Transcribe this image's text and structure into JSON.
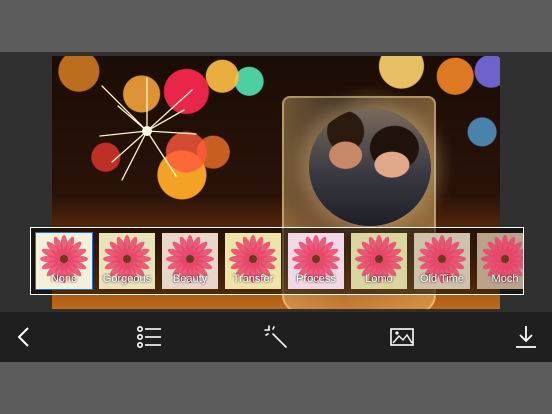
{
  "filters": [
    {
      "label": "None",
      "tint": "#f4f1d8",
      "selected": true
    },
    {
      "label": "Gorgeous",
      "tint": "#e8e3b8"
    },
    {
      "label": "Beauty",
      "tint": "#e7d6c9"
    },
    {
      "label": "Transfer",
      "tint": "#efe4a8"
    },
    {
      "label": "Process",
      "tint": "#f0d9e6"
    },
    {
      "label": "Lomo",
      "tint": "#d9d6a0"
    },
    {
      "label": "Old Time",
      "tint": "#cfc2ad"
    },
    {
      "label": "Moch",
      "tint": "#b9a38d"
    }
  ],
  "toolbar": {
    "icons": [
      "back-icon",
      "list-icon",
      "magic-wand-icon",
      "image-icon",
      "download-icon"
    ]
  },
  "colors": {
    "accent": "#1f6fe0",
    "toolbar_bg": "#1f1f1f",
    "flower": "#e8456b"
  }
}
